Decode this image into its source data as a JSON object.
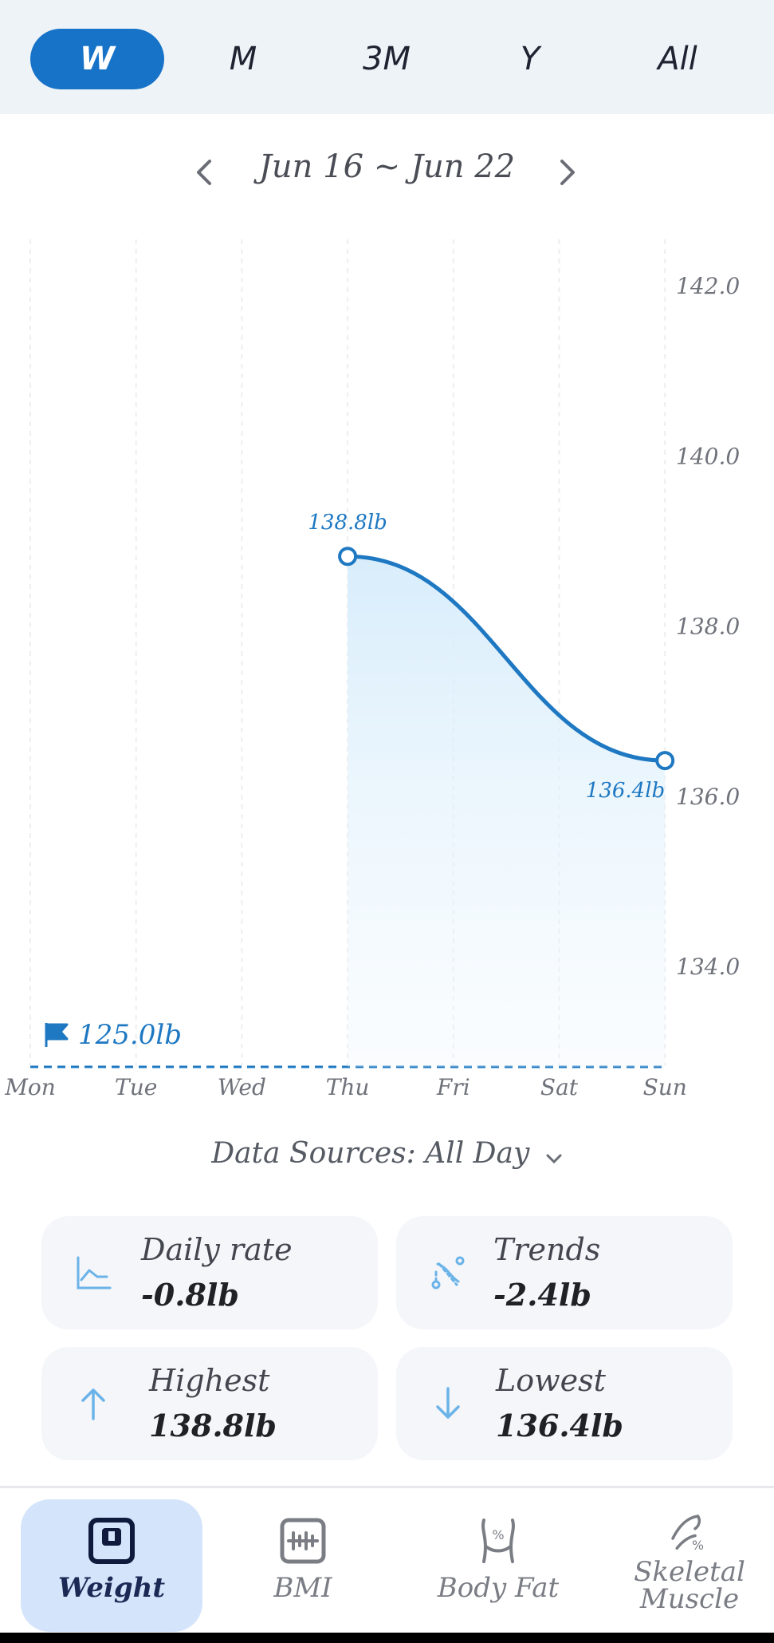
{
  "period_tabs": [
    "W",
    "M",
    "3M",
    "Y",
    "All"
  ],
  "active_period": "W",
  "date_range": "Jun 16 ~ Jun 22",
  "chart_data": {
    "type": "line",
    "x": [
      "Mon",
      "Tue",
      "Wed",
      "Thu",
      "Fri",
      "Sat",
      "Sun"
    ],
    "series": [
      {
        "values": [
          null,
          null,
          null,
          138.8,
          null,
          null,
          136.4
        ]
      }
    ],
    "y_ticks": [
      "142.0",
      "140.0",
      "138.0",
      "136.0",
      "134.0"
    ],
    "ylim": [
      132.8,
      142.0
    ],
    "point_labels": [
      "138.8lb",
      "136.4lb"
    ],
    "goal_label": "125.0lb",
    "accent": "#1e78c2",
    "grid": "vertical dashed"
  },
  "data_source": "Data Sources: All Day",
  "stats": {
    "daily_rate_label": "Daily rate",
    "daily_rate_value": "-0.8lb",
    "trends_label": "Trends",
    "trends_value": "-2.4lb",
    "highest_label": "Highest",
    "highest_value": "138.8lb",
    "lowest_label": "Lowest",
    "lowest_value": "136.4lb"
  },
  "nav": [
    "Weight",
    "BMI",
    "Body Fat",
    "Skeletal\nMuscle"
  ],
  "active_nav": "Weight"
}
